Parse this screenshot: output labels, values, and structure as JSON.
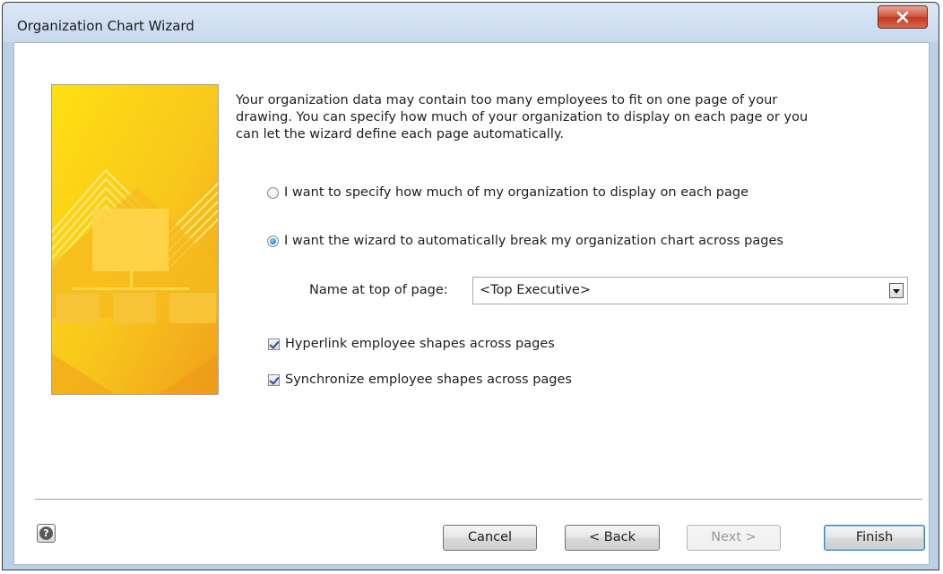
{
  "window": {
    "title": "Organization Chart Wizard"
  },
  "intro_text": "Your organization data may contain too many employees to fit on one page of your\ndrawing.  You can specify how much of your organization to display on each page or you\ncan let the wizard define each page automatically.",
  "options": {
    "manual_label": "I want to specify how much of my organization to display on each page",
    "manual_checked": false,
    "auto_label": "I want the wizard to automatically break my organization chart across pages",
    "auto_checked": true
  },
  "top_of_page": {
    "label": "Name at top of page:",
    "value": "<Top Executive>"
  },
  "checkboxes": {
    "hyperlink_label": "Hyperlink employee shapes across pages",
    "hyperlink_checked": true,
    "synchronize_label": "Synchronize employee shapes across pages",
    "synchronize_checked": true
  },
  "buttons": {
    "cancel": "Cancel",
    "back": "< Back",
    "next": "Next >",
    "finish": "Finish",
    "help": "?"
  },
  "icons": {
    "close": "close-icon",
    "help": "help-icon",
    "dropdown": "chevron-down-icon"
  },
  "colors": {
    "banner_yellow": "#f7cc1c",
    "banner_orange": "#f3a51b",
    "title_bar": "#d3e2f3",
    "close_red": "#c9462b"
  }
}
